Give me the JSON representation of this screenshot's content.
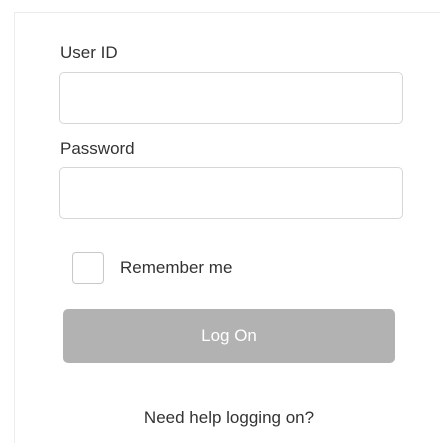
{
  "login": {
    "userid_label": "User ID",
    "userid_value": "",
    "password_label": "Password",
    "password_value": "",
    "remember_label": "Remember me",
    "remember_checked": false,
    "logon_label": "Log On",
    "help_link": "Need help logging on?"
  },
  "colors": {
    "button_bg": "#b2b2b2",
    "button_text": "#ffffff",
    "field_border": "#d6d6d6",
    "text": "#333333"
  }
}
